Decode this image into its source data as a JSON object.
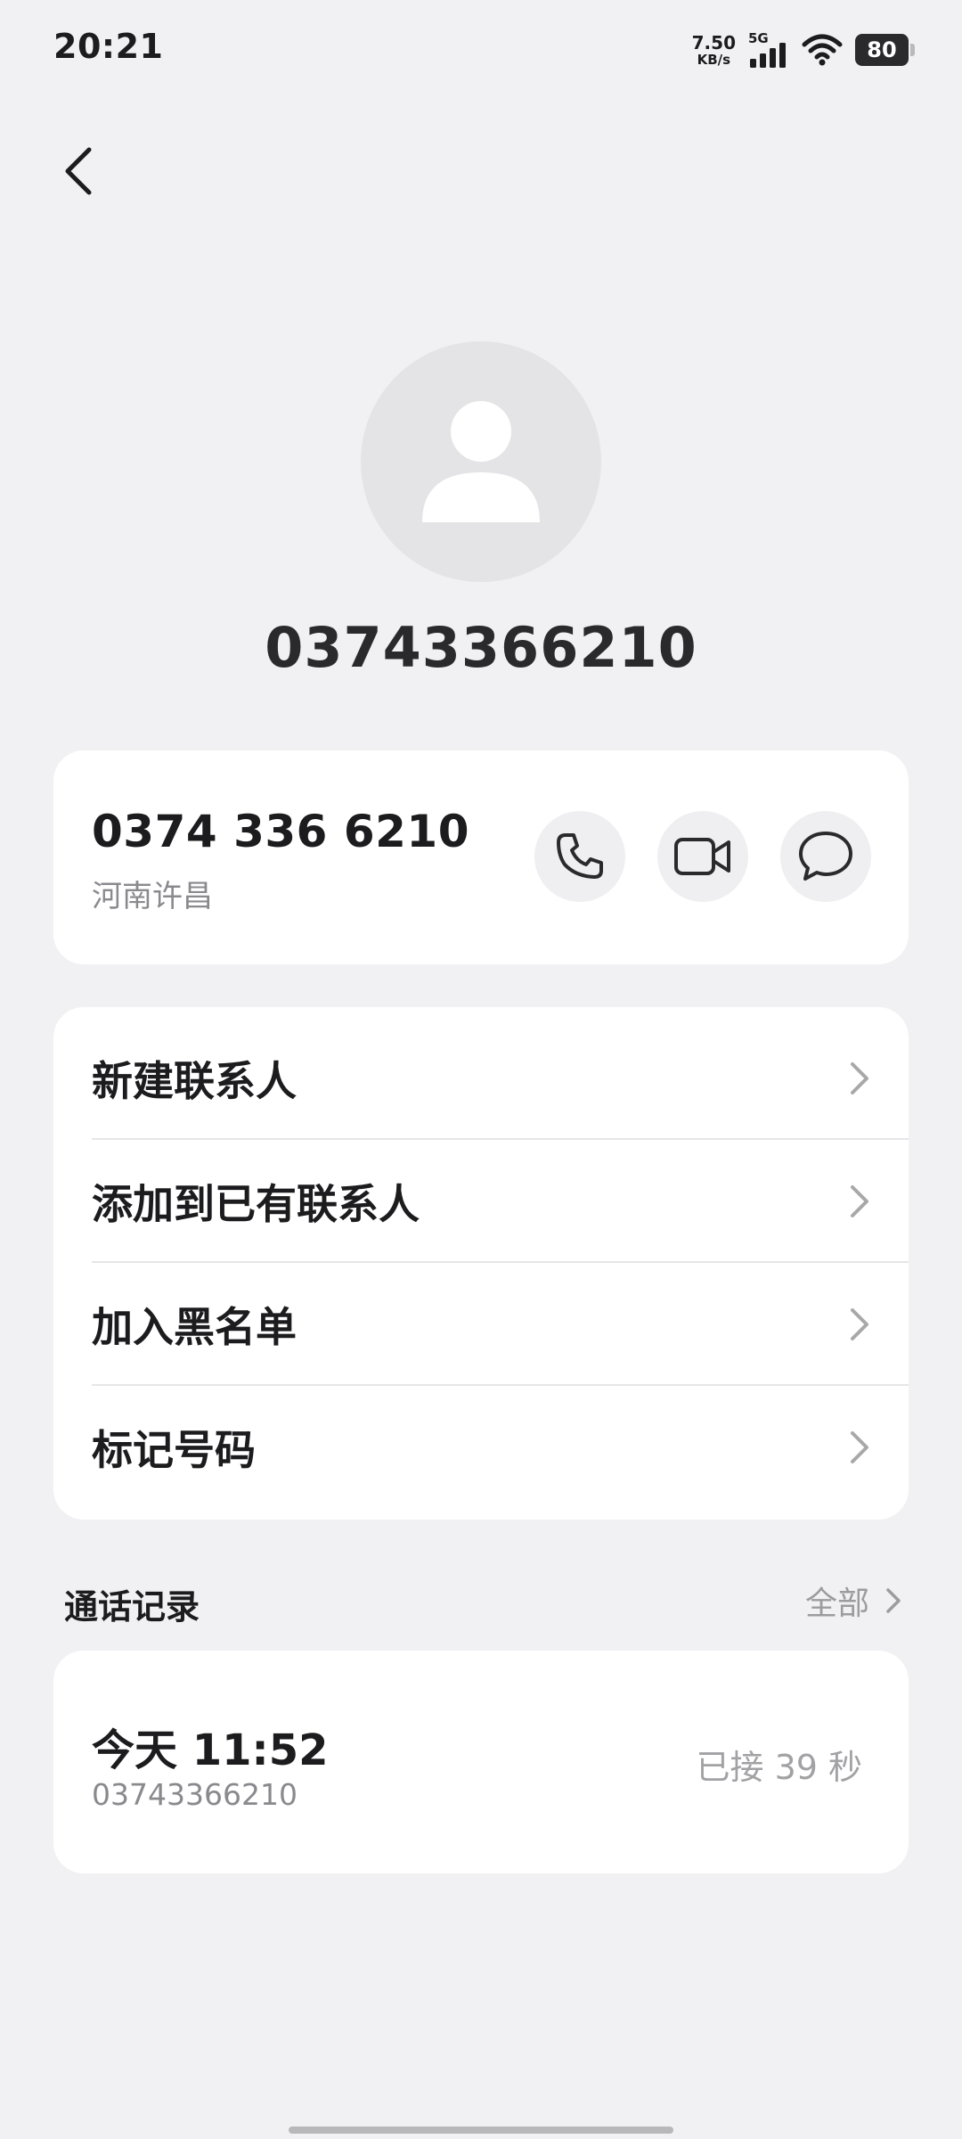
{
  "status_bar": {
    "time": "20:21",
    "net_speed_value": "7.50",
    "net_speed_unit": "KB/s",
    "network_type": "5G",
    "battery_level": "80",
    "icons": [
      "signal-icon",
      "wifi-icon",
      "battery-icon"
    ]
  },
  "header": {
    "back_icon": "chevron-left-icon"
  },
  "contact": {
    "avatar_icon": "person-icon",
    "title": "03743366210",
    "formatted_number": "0374 336 6210",
    "location": "河南许昌",
    "actions": [
      {
        "name": "call",
        "icon": "phone-icon"
      },
      {
        "name": "video-call",
        "icon": "video-icon"
      },
      {
        "name": "message",
        "icon": "chat-bubble-icon"
      }
    ]
  },
  "menu": {
    "items": [
      {
        "label": "新建联系人"
      },
      {
        "label": "添加到已有联系人"
      },
      {
        "label": "加入黑名单"
      },
      {
        "label": "标记号码"
      }
    ]
  },
  "call_log": {
    "section_title": "通话记录",
    "see_all_label": "全部",
    "entries": [
      {
        "time": "今天 11:52",
        "number": "03743366210",
        "status": "已接 39 秒"
      }
    ]
  },
  "colors": {
    "background": "#f1f1f3",
    "card": "#ffffff",
    "text_primary": "#1c1c1e",
    "text_secondary": "#8a8a8e",
    "button_bg": "#efeff1"
  }
}
